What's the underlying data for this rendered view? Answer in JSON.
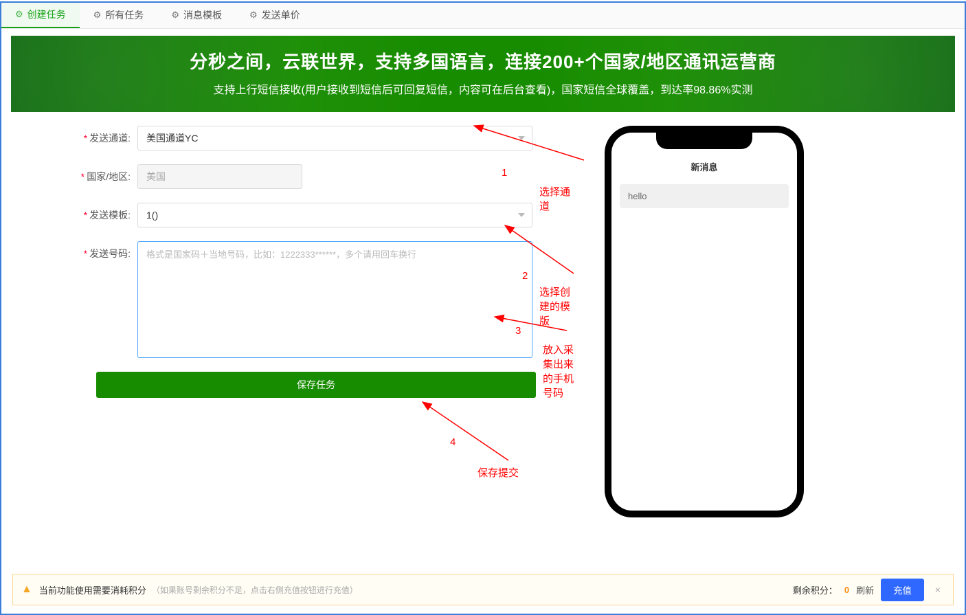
{
  "tabs": {
    "create": "创建任务",
    "all": "所有任务",
    "template": "消息模板",
    "price": "发送单价"
  },
  "banner": {
    "title": "分秒之间，云联世界，支持多国语言，连接200+个国家/地区通讯运营商",
    "subtitle": "支持上行短信接收(用户接收到短信后可回复短信，内容可在后台查看)，国家短信全球覆盖，到达率98.86%实测"
  },
  "form": {
    "channel_label": "发送通道:",
    "channel_value": "美国通道YC",
    "country_label": "国家/地区:",
    "country_value": "美国",
    "template_label": "发送模板:",
    "template_value": "1()",
    "numbers_label": "发送号码:",
    "numbers_placeholder": "格式是国家码＋当地号码，比如：1222333******，多个请用回车换行",
    "save_button": "保存任务"
  },
  "annotations": {
    "n1": "1",
    "a1": "选择通道",
    "n2": "2",
    "a2": "选择创建的模版",
    "n3": "3",
    "a3": "放入采集出来的手机号码",
    "n4": "4",
    "a4": "保存提交"
  },
  "phone": {
    "header": "新消息",
    "message": "hello"
  },
  "footer": {
    "main": "当前功能使用需要消耗积分",
    "sub": "（如果账号剩余积分不足，点击右侧充值按钮进行充值）",
    "points_label": "剩余积分：",
    "points_value": "0",
    "refresh": "刷新",
    "recharge": "充值",
    "close": "×"
  }
}
